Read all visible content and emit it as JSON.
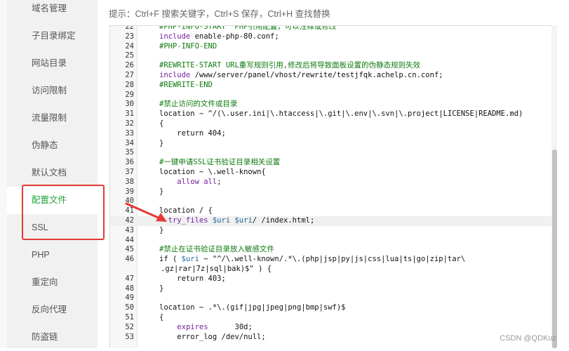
{
  "sidebar": {
    "items": [
      {
        "label": "域名管理",
        "active": false
      },
      {
        "label": "子目录绑定",
        "active": false
      },
      {
        "label": "网站目录",
        "active": false
      },
      {
        "label": "访问限制",
        "active": false
      },
      {
        "label": "流量限制",
        "active": false
      },
      {
        "label": "伪静态",
        "active": false
      },
      {
        "label": "默认文档",
        "active": false
      },
      {
        "label": "配置文件",
        "active": true
      },
      {
        "label": "SSL",
        "active": false
      },
      {
        "label": "PHP",
        "active": false
      },
      {
        "label": "重定向",
        "active": false
      },
      {
        "label": "反向代理",
        "active": false
      },
      {
        "label": "防盗链",
        "active": false
      }
    ]
  },
  "hint": "提示：Ctrl+F 搜索关键字，Ctrl+S 保存，Ctrl+H 查找替换",
  "editor": {
    "current_line": "42",
    "lines": [
      {
        "n": "22",
        "tokens": [
          {
            "t": "#PHP-INFO-START  PHP引用配置，可以注释或修改",
            "c": "cm"
          }
        ]
      },
      {
        "n": "23",
        "tokens": [
          {
            "t": "include",
            "c": "kw"
          },
          {
            "t": " enable-php-80.conf;",
            "c": "txt"
          }
        ]
      },
      {
        "n": "24",
        "tokens": [
          {
            "t": "#PHP-INFO-END",
            "c": "cm"
          }
        ]
      },
      {
        "n": "25",
        "tokens": []
      },
      {
        "n": "26",
        "tokens": [
          {
            "t": "#REWRITE-START URL重写规则引用,修改后将导致面板设置的伪静态规则失效",
            "c": "cm"
          }
        ]
      },
      {
        "n": "27",
        "tokens": [
          {
            "t": "include",
            "c": "kw"
          },
          {
            "t": " /www/server/panel/vhost/rewrite/testjfqk.achelp.cn.conf;",
            "c": "txt"
          }
        ]
      },
      {
        "n": "28",
        "tokens": [
          {
            "t": "#REWRITE-END",
            "c": "cm"
          }
        ]
      },
      {
        "n": "29",
        "tokens": []
      },
      {
        "n": "30",
        "tokens": [
          {
            "t": "#禁止访问的文件或目录",
            "c": "cm"
          }
        ]
      },
      {
        "n": "31",
        "tokens": [
          {
            "t": "location ~ ^/(\\.user.ini|\\.htaccess|\\.git|\\.env|\\.svn|\\.project|LICENSE|README.md)",
            "c": "txt"
          }
        ]
      },
      {
        "n": "32",
        "tokens": [
          {
            "t": "{",
            "c": "txt"
          }
        ]
      },
      {
        "n": "33",
        "tokens": [
          {
            "t": "    return 404;",
            "c": "txt"
          }
        ]
      },
      {
        "n": "34",
        "tokens": [
          {
            "t": "}",
            "c": "txt"
          }
        ]
      },
      {
        "n": "35",
        "tokens": []
      },
      {
        "n": "36",
        "tokens": [
          {
            "t": "#一键申请SSL证书验证目录相关设置",
            "c": "cm"
          }
        ]
      },
      {
        "n": "37",
        "tokens": [
          {
            "t": "location ~ \\.well-known{",
            "c": "txt"
          }
        ]
      },
      {
        "n": "38",
        "tokens": [
          {
            "t": "    ",
            "c": "txt"
          },
          {
            "t": "allow all",
            "c": "kw"
          },
          {
            "t": ";",
            "c": "txt"
          }
        ]
      },
      {
        "n": "39",
        "tokens": [
          {
            "t": "}",
            "c": "txt"
          }
        ]
      },
      {
        "n": "40",
        "tokens": []
      },
      {
        "n": "41",
        "tokens": [
          {
            "t": "location / {",
            "c": "txt"
          }
        ]
      },
      {
        "n": "42",
        "tokens": [
          {
            "t": "  try_files ",
            "c": "kw"
          },
          {
            "t": "$uri",
            "c": "var"
          },
          {
            "t": " ",
            "c": "txt"
          },
          {
            "t": "$uri",
            "c": "var"
          },
          {
            "t": "/ /index.html;",
            "c": "txt"
          }
        ]
      },
      {
        "n": "43",
        "tokens": [
          {
            "t": "}",
            "c": "txt"
          }
        ]
      },
      {
        "n": "44",
        "tokens": []
      },
      {
        "n": "45",
        "tokens": [
          {
            "t": "#禁止在证书验证目录放入敏感文件",
            "c": "cm"
          }
        ]
      },
      {
        "n": "46",
        "tokens": [
          {
            "t": "if ( ",
            "c": "txt"
          },
          {
            "t": "$uri",
            "c": "var"
          },
          {
            "t": " ~ \"^/\\.well-known/.*\\.(php|jsp|py|js|css|lua|ts|go|zip|tar\\",
            "c": "txt"
          }
        ]
      },
      {
        "n": "",
        "tokens": [
          {
            "t": ".gz|rar|7z|sql|bak)$\" ) {",
            "c": "txt"
          }
        ]
      },
      {
        "n": "47",
        "tokens": [
          {
            "t": "    return 403;",
            "c": "txt"
          }
        ]
      },
      {
        "n": "48",
        "tokens": [
          {
            "t": "}",
            "c": "txt"
          }
        ]
      },
      {
        "n": "49",
        "tokens": []
      },
      {
        "n": "50",
        "tokens": [
          {
            "t": "location ~ .*\\.(gif|jpg|jpeg|png|bmp|swf)$",
            "c": "txt"
          }
        ]
      },
      {
        "n": "51",
        "tokens": [
          {
            "t": "{",
            "c": "txt"
          }
        ]
      },
      {
        "n": "52",
        "tokens": [
          {
            "t": "    ",
            "c": "txt"
          },
          {
            "t": "expires",
            "c": "kw"
          },
          {
            "t": "      30d;",
            "c": "txt"
          }
        ]
      },
      {
        "n": "53",
        "tokens": [
          {
            "t": "    error_log /dev/null;",
            "c": "txt"
          }
        ]
      }
    ]
  },
  "watermark": "CSDN @QDKuz",
  "colors": {
    "accent": "#20a53a",
    "highlight": "#e53935",
    "comment": "#0f7a0f",
    "keyword": "#7a1fa2",
    "variable": "#256a9c"
  }
}
